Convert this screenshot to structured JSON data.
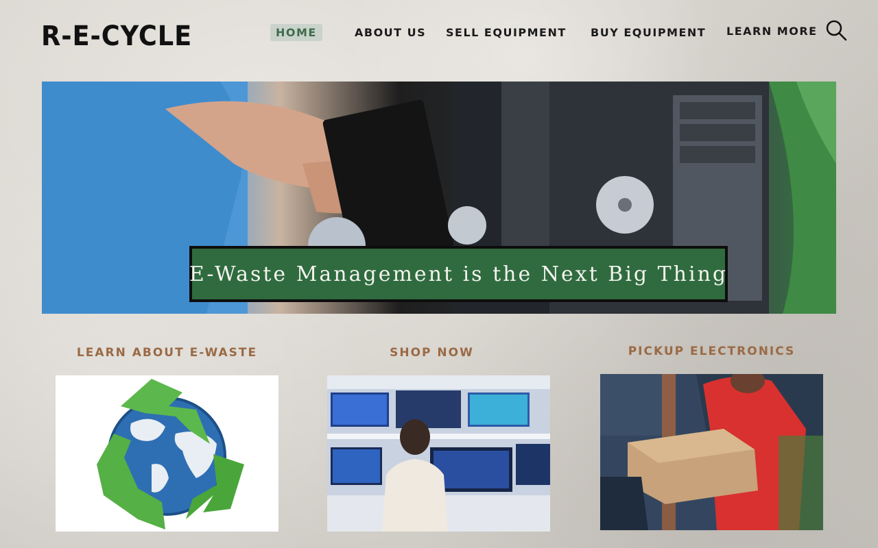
{
  "site": {
    "logo": "R-E-CYCLE"
  },
  "nav": {
    "items": [
      {
        "label": "HOME",
        "active": true
      },
      {
        "label": "ABOUT US",
        "active": false
      },
      {
        "label": "SELL EQUIPMENT",
        "active": false
      },
      {
        "label": "BUY EQUIPMENT",
        "active": false
      },
      {
        "label": "LEARN MORE",
        "active": false
      }
    ],
    "search_icon": "search-icon"
  },
  "hero": {
    "headline": "E-Waste Management is the Next Big Thing"
  },
  "cards": [
    {
      "title": "LEARN ABOUT E-WASTE",
      "image": "recycle-globe"
    },
    {
      "title": "SHOP NOW",
      "image": "electronics-store"
    },
    {
      "title": "PICKUP ELECTRONICS",
      "image": "package-delivery"
    }
  ],
  "colors": {
    "accent_green": "#2f6b3f",
    "active_nav_bg": "#c9d3cb",
    "card_title": "#9a6a45"
  }
}
